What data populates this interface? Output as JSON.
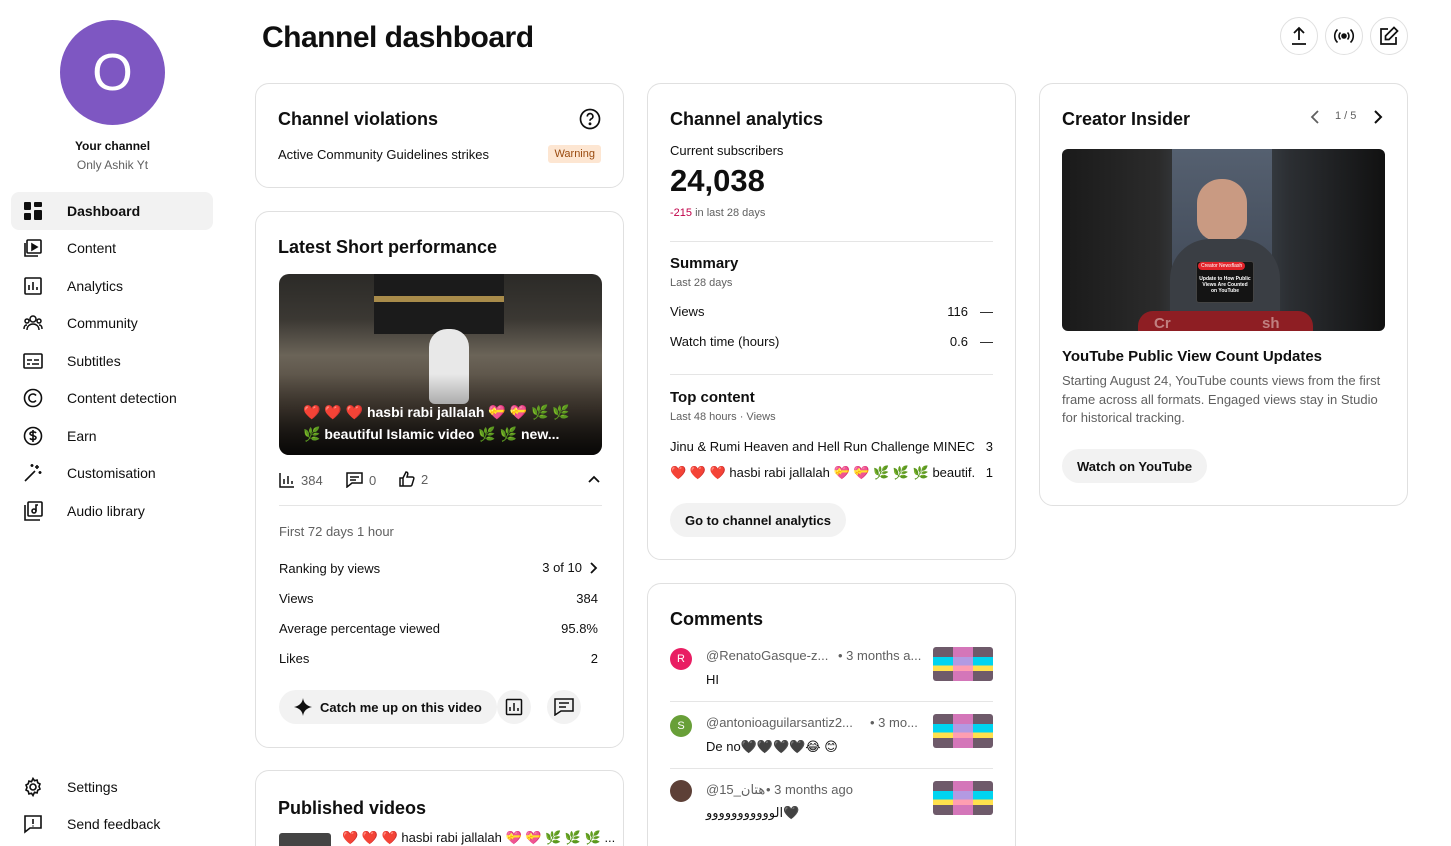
{
  "sidebar": {
    "avatar_letter": "O",
    "your_channel": "Your channel",
    "channel_name": "Only Ashik Yt",
    "items": [
      {
        "label": "Dashboard",
        "icon": "dashboard-icon",
        "active": true
      },
      {
        "label": "Content",
        "icon": "content-icon"
      },
      {
        "label": "Analytics",
        "icon": "analytics-icon"
      },
      {
        "label": "Community",
        "icon": "community-icon"
      },
      {
        "label": "Subtitles",
        "icon": "subtitles-icon"
      },
      {
        "label": "Content detection",
        "icon": "copyright-icon"
      },
      {
        "label": "Earn",
        "icon": "dollar-icon"
      },
      {
        "label": "Customisation",
        "icon": "magic-wand-icon"
      },
      {
        "label": "Audio library",
        "icon": "audio-library-icon"
      }
    ],
    "bottom_items": [
      {
        "label": "Settings",
        "icon": "gear-icon"
      },
      {
        "label": "Send feedback",
        "icon": "feedback-icon"
      }
    ]
  },
  "header": {
    "title": "Channel dashboard",
    "actions": [
      "upload-icon",
      "live-icon",
      "create-post-icon"
    ]
  },
  "violations": {
    "title": "Channel violations",
    "strikes_label": "Active Community Guidelines strikes",
    "badge": "Warning"
  },
  "short_perf": {
    "title": "Latest Short performance",
    "video_title_line1": "❤️ ❤️ ❤️ hasbi rabi jallalah 💝 💝 🌿 🌿",
    "video_title_line2": "🌿 beautiful Islamic video 🌿 🌿 new...",
    "views_count": "384",
    "comments_count": "0",
    "likes_count": "2",
    "period": "First 72 days 1 hour",
    "ranking_label": "Ranking by views",
    "ranking_value": "3 of 10",
    "views_label": "Views",
    "views_value": "384",
    "avg_label": "Average percentage viewed",
    "avg_value": "95.8%",
    "likes_label": "Likes",
    "likes_value": "2",
    "catch_up": "Catch me up on this video"
  },
  "published": {
    "title": "Published videos",
    "first_title": "❤️ ❤️ ❤️ hasbi rabi jallalah 💝 💝 🌿 🌿 🌿 ..."
  },
  "analytics": {
    "title": "Channel analytics",
    "subs_label": "Current subscribers",
    "subs_value": "24,038",
    "subs_change": "-215",
    "subs_change_suffix": "in last 28 days",
    "summary_title": "Summary",
    "summary_period": "Last 28 days",
    "views_label": "Views",
    "views_value": "116",
    "watch_label": "Watch time (hours)",
    "watch_value": "0.6",
    "dash": "—",
    "top_title": "Top content",
    "top_period": "Last 48 hours · Views",
    "top_items": [
      {
        "title": "Jinu & Rumi Heaven and Hell Run Challenge MINEC...",
        "views": "3"
      },
      {
        "title": "❤️ ❤️ ❤️ hasbi rabi jallalah 💝 💝 🌿 🌿 🌿 beautif...",
        "views": "1"
      }
    ],
    "go_button": "Go to channel analytics"
  },
  "comments": {
    "title": "Comments",
    "items": [
      {
        "avatar": "R",
        "avatar_color": "#e91e63",
        "author": "@RenatoGasque-z...",
        "time": "• 3 months a...",
        "text": "HI"
      },
      {
        "avatar": "S",
        "avatar_color": "#689f38",
        "author": "@antonioaguilarsantiz2...",
        "time": "• 3 mo...",
        "text": "De no🖤🖤🖤🖤😂 😊"
      },
      {
        "avatar": "",
        "avatar_color": "#5d4037",
        "author": "@15_هتان",
        "time": "• 3 months ago",
        "text": "الووووووووووو🖤"
      }
    ]
  },
  "insider": {
    "title": "Creator Insider",
    "pager": "1 / 5",
    "thumb_badge": "Creator Newsflash",
    "thumb_text": "Update to How Public Views Are Counted on YouTube",
    "thumb_bg_left": "Cr",
    "thumb_bg_right": "sh",
    "video_title": "YouTube Public View Count Updates",
    "description": "Starting August 24, YouTube counts views from the first frame across all formats. Engaged views stay in Studio for historical tracking.",
    "watch_button": "Watch on YouTube"
  }
}
